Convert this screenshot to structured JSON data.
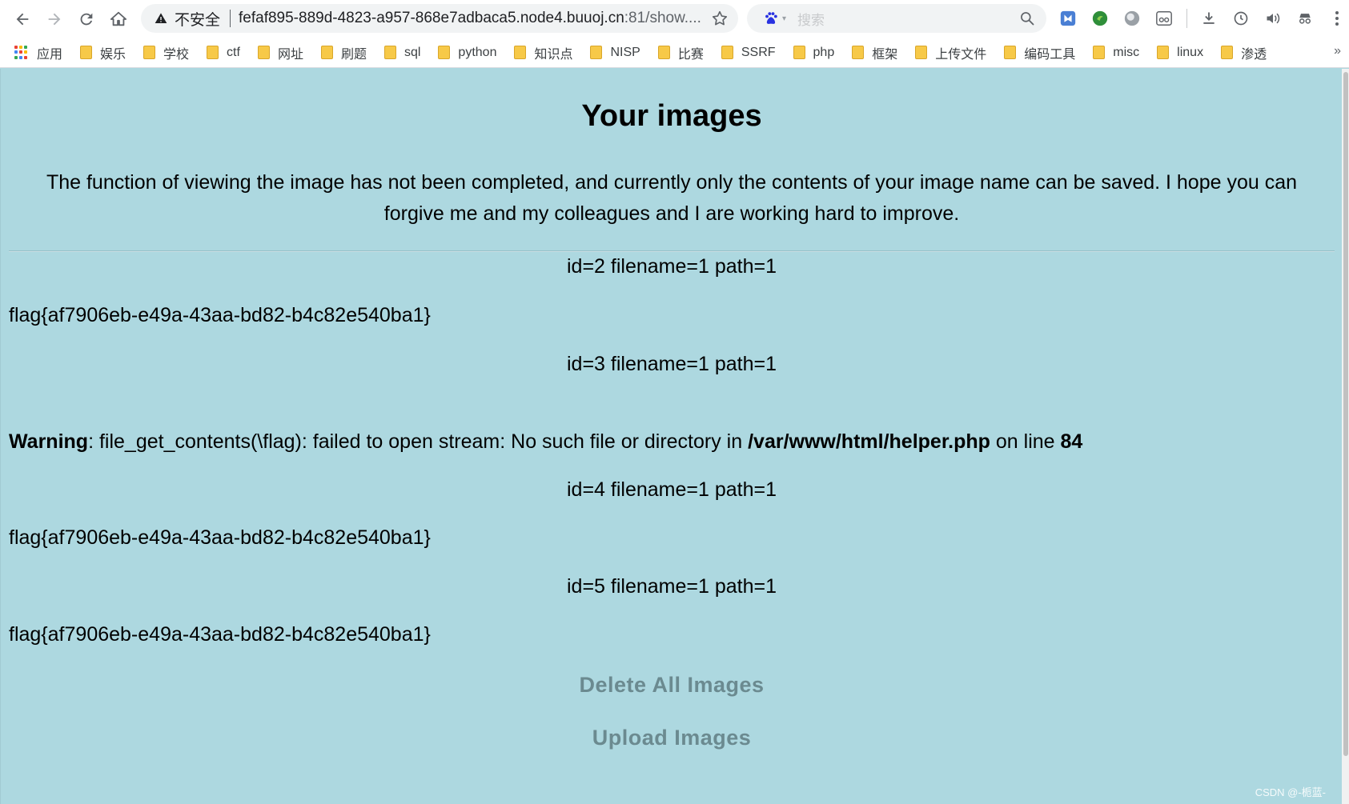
{
  "browser": {
    "security_label": "不安全",
    "url_main": "fefaf895-889d-4823-a957-868e7adbaca5.node4.buuoj.cn",
    "url_rest": ":81/show....",
    "search_placeholder": "搜索"
  },
  "bookmarks": [
    {
      "label": "应用",
      "type": "apps"
    },
    {
      "label": "娱乐",
      "type": "folder"
    },
    {
      "label": "学校",
      "type": "folder"
    },
    {
      "label": "ctf",
      "type": "folder"
    },
    {
      "label": "网址",
      "type": "folder"
    },
    {
      "label": "刷题",
      "type": "folder"
    },
    {
      "label": "sql",
      "type": "folder"
    },
    {
      "label": "python",
      "type": "folder"
    },
    {
      "label": "知识点",
      "type": "folder"
    },
    {
      "label": "NISP",
      "type": "folder"
    },
    {
      "label": "比赛",
      "type": "folder"
    },
    {
      "label": "SSRF",
      "type": "folder"
    },
    {
      "label": "php",
      "type": "folder"
    },
    {
      "label": "框架",
      "type": "folder"
    },
    {
      "label": "上传文件",
      "type": "folder"
    },
    {
      "label": "编码工具",
      "type": "folder"
    },
    {
      "label": "misc",
      "type": "folder"
    },
    {
      "label": "linux",
      "type": "folder"
    },
    {
      "label": "渗透",
      "type": "folder"
    }
  ],
  "bookmarks_more": "»",
  "page": {
    "title": "Your images",
    "intro": "The function of viewing the image has not been completed, and currently only the contents of your image name can be saved. I hope you can forgive me and my colleagues and I are working hard to improve.",
    "records": [
      {
        "info": "id=2 filename=1 path=1",
        "content": "flag{af7906eb-e49a-43aa-bd82-b4c82e540ba1}"
      },
      {
        "info": "id=3 filename=1 path=1",
        "content": ""
      },
      {
        "info": "id=4 filename=1 path=1",
        "content": "flag{af7906eb-e49a-43aa-bd82-b4c82e540ba1}"
      },
      {
        "info": "id=5 filename=1 path=1",
        "content": "flag{af7906eb-e49a-43aa-bd82-b4c82e540ba1}"
      }
    ],
    "warning": {
      "label": "Warning",
      "message": ": file_get_contents(\\flag): failed to open stream: No such file or directory in ",
      "file": "/var/www/html/helper.php",
      "on_line": " on line ",
      "line": "84"
    },
    "delete_label": "Delete All Images",
    "upload_label": "Upload Images"
  },
  "watermark": "CSDN @-栀蓝-",
  "colors": {
    "page_bg": "#add8e0",
    "action_text": "#6b8a90",
    "bookmark_folder": "#f7c948"
  }
}
